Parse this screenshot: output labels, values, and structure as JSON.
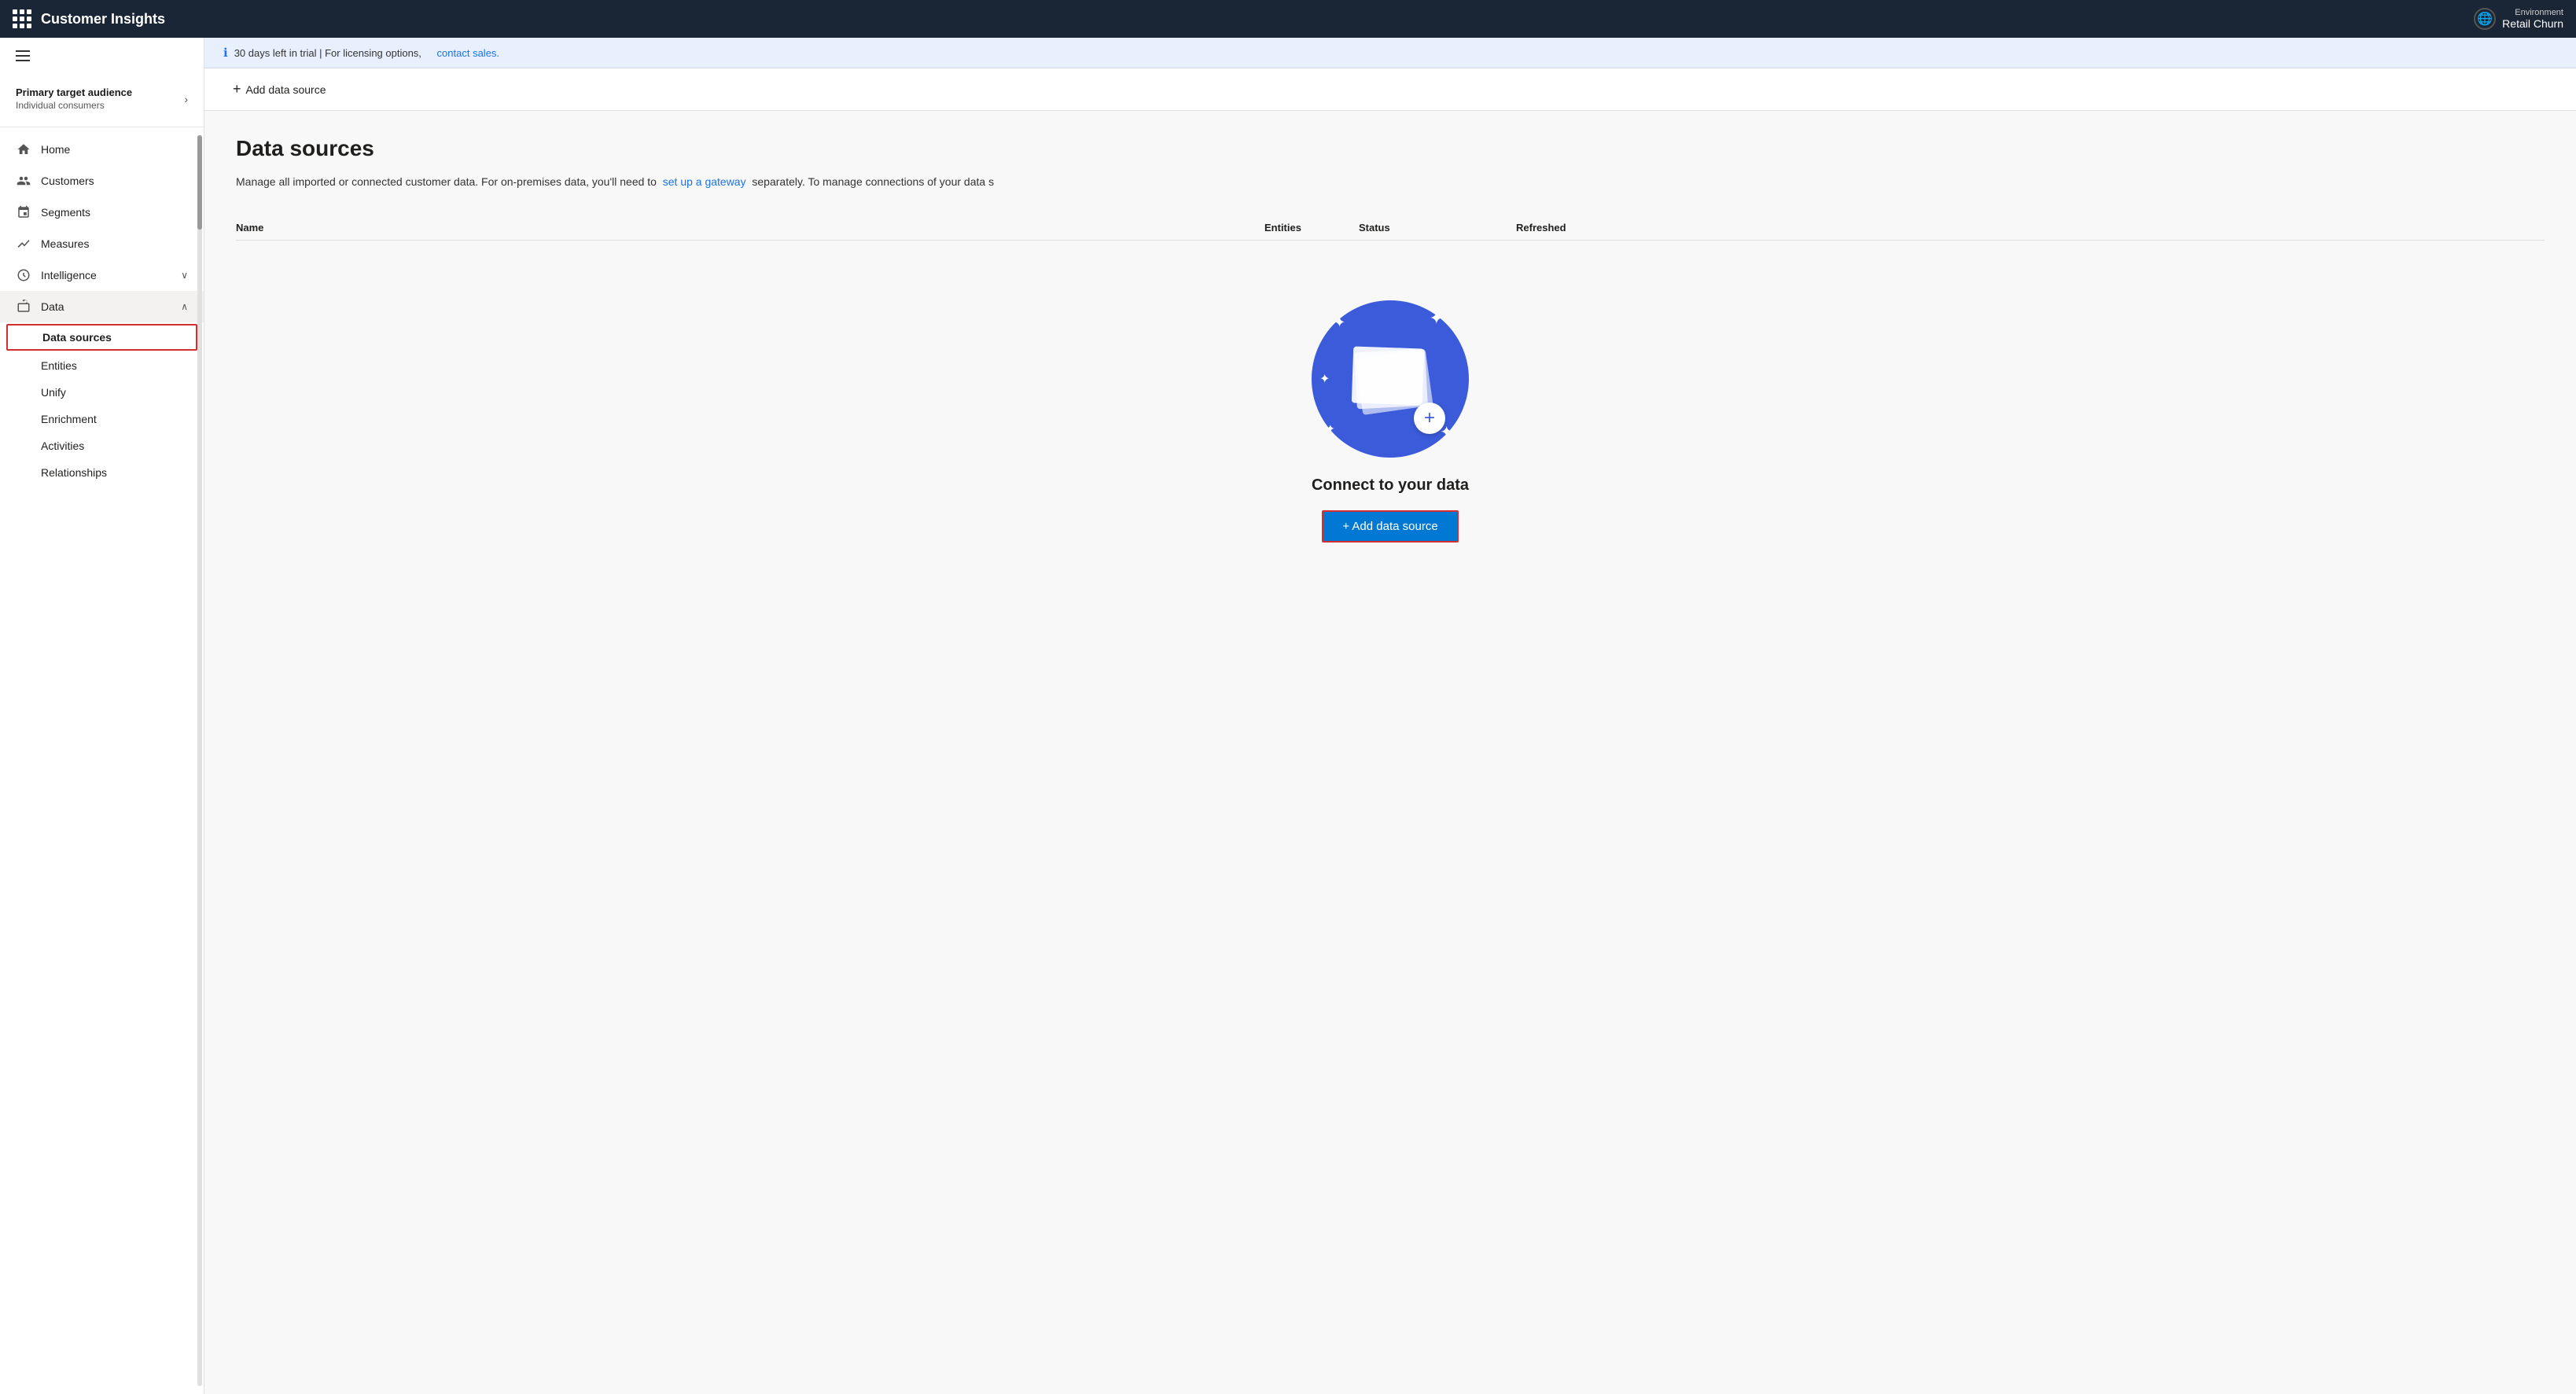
{
  "app": {
    "title": "Customer Insights"
  },
  "environment": {
    "label": "Environment",
    "name": "Retail Churn"
  },
  "trial": {
    "message": "30 days left in trial | For licensing options,",
    "link_text": "contact sales.",
    "link_url": "#"
  },
  "toolbar": {
    "add_button_label": "Add data source"
  },
  "sidebar": {
    "audience": {
      "title": "Primary target audience",
      "subtitle": "Individual consumers"
    },
    "nav_items": [
      {
        "id": "home",
        "label": "Home",
        "icon": "home"
      },
      {
        "id": "customers",
        "label": "Customers",
        "icon": "customers"
      },
      {
        "id": "segments",
        "label": "Segments",
        "icon": "segments"
      },
      {
        "id": "measures",
        "label": "Measures",
        "icon": "measures"
      },
      {
        "id": "intelligence",
        "label": "Intelligence",
        "icon": "intelligence",
        "has_arrow": true,
        "arrow_down": true
      },
      {
        "id": "data",
        "label": "Data",
        "icon": "data",
        "has_arrow": true,
        "arrow_up": true
      }
    ],
    "data_sub_items": [
      {
        "id": "data-sources",
        "label": "Data sources",
        "selected": true
      },
      {
        "id": "entities",
        "label": "Entities"
      },
      {
        "id": "unify",
        "label": "Unify"
      },
      {
        "id": "enrichment",
        "label": "Enrichment"
      },
      {
        "id": "activities",
        "label": "Activities"
      },
      {
        "id": "relationships",
        "label": "Relationships"
      }
    ]
  },
  "page": {
    "title": "Data sources",
    "description_start": "Manage all imported or connected customer data. For on-premises data, you'll need to",
    "description_link_text": "set up a gateway",
    "description_end": "separately. To manage connections of your data s",
    "table_headers": {
      "name": "Name",
      "entities": "Entities",
      "status": "Status",
      "refreshed": "Refreshed"
    },
    "empty_state": {
      "title": "Connect to your data",
      "add_button": "+ Add data source"
    }
  }
}
